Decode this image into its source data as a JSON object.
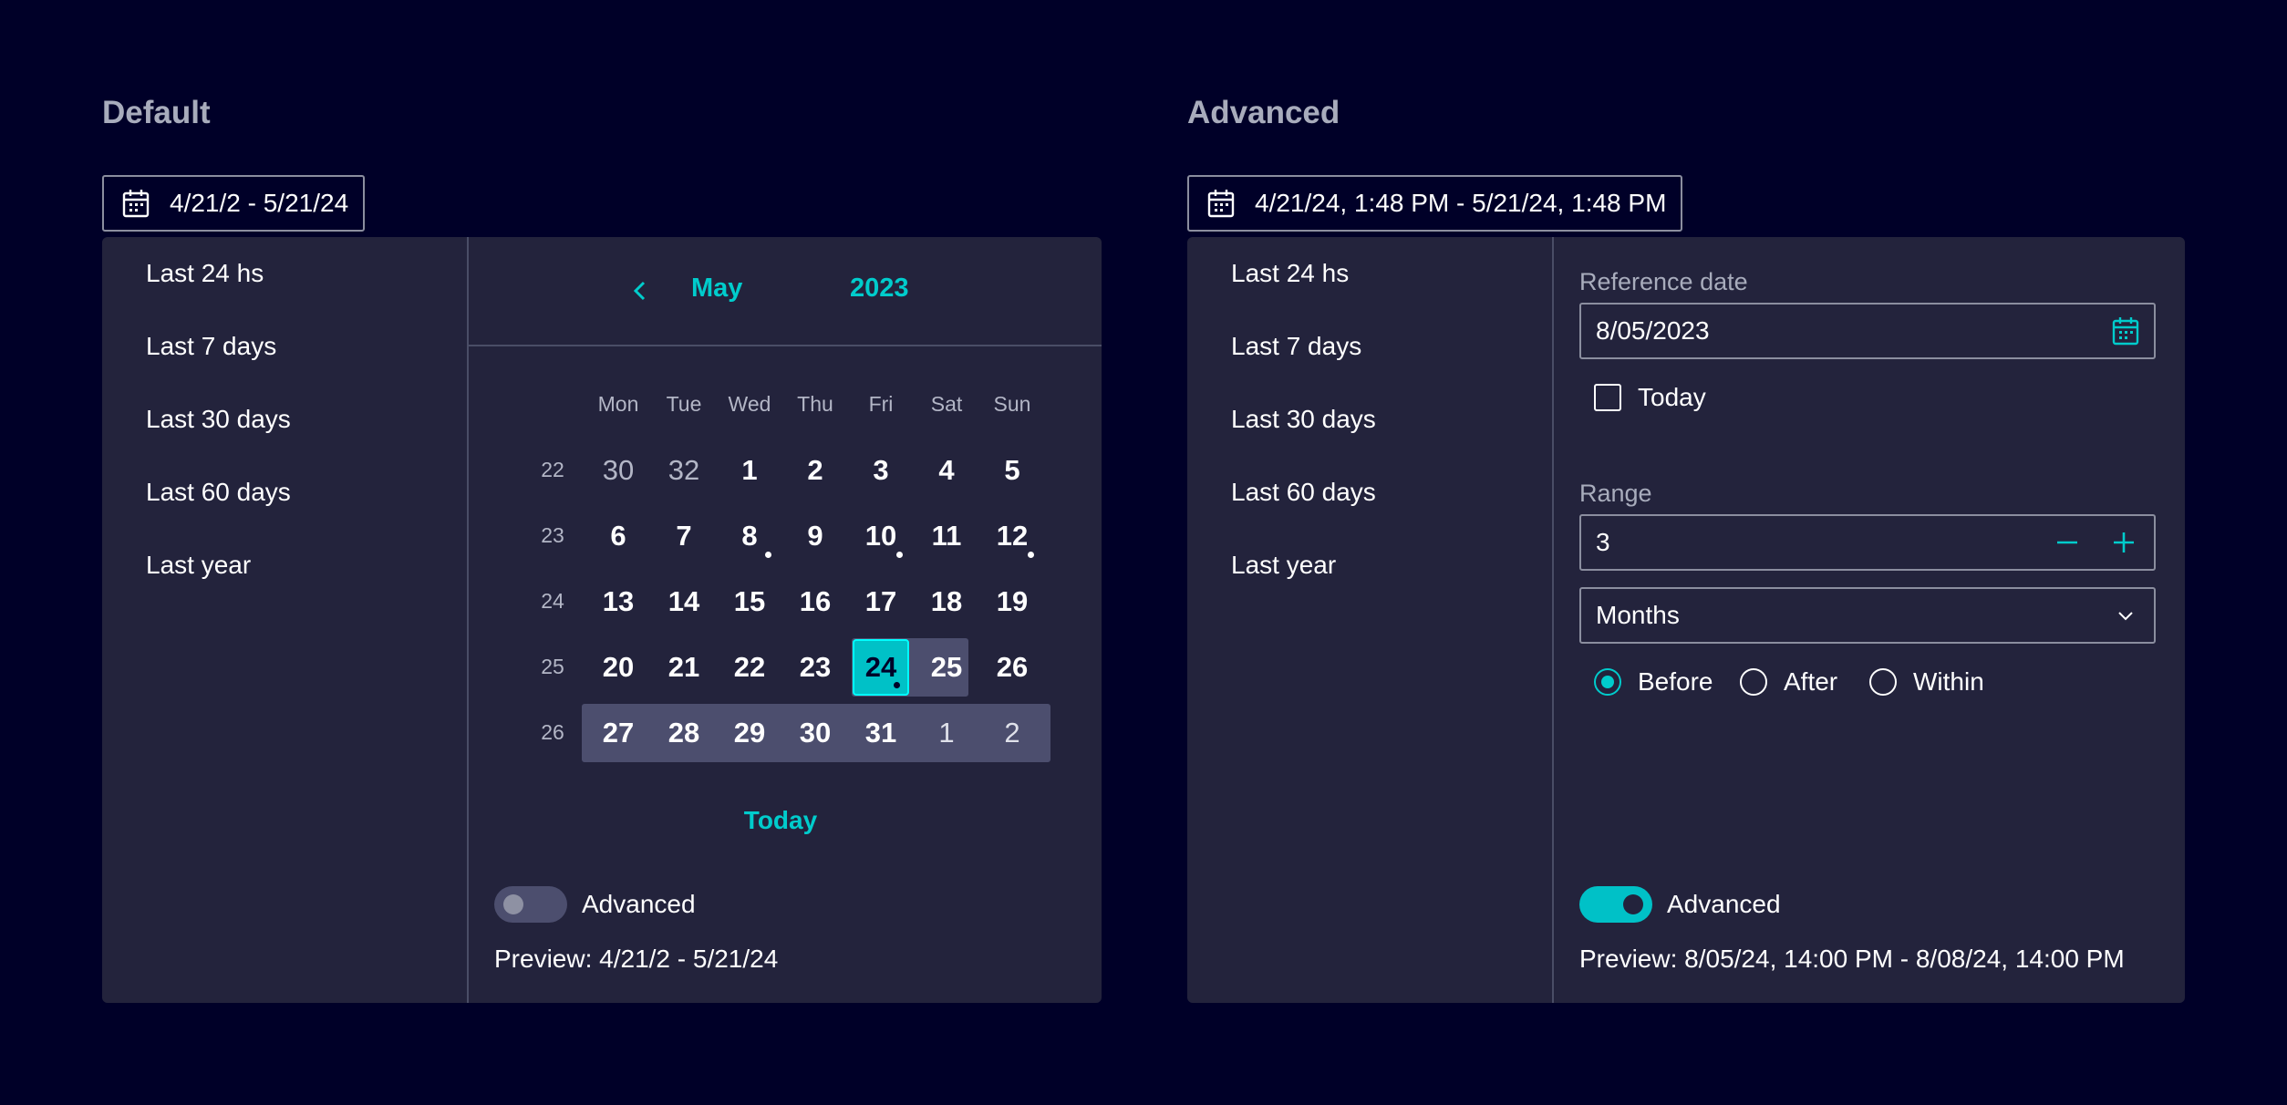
{
  "default": {
    "title": "Default",
    "trigger_value": "4/21/2 - 5/21/24",
    "presets": [
      "Last 24 hs",
      "Last 7 days",
      "Last 30 days",
      "Last 60 days",
      "Last year"
    ],
    "calendar": {
      "month": "May",
      "year": "2023",
      "weekdays": [
        "Mon",
        "Tue",
        "Wed",
        "Thu",
        "Fri",
        "Sat",
        "Sun"
      ],
      "weeks": [
        {
          "num": "22",
          "days": [
            "30",
            "32",
            "1",
            "2",
            "3",
            "4",
            "5"
          ]
        },
        {
          "num": "23",
          "days": [
            "6",
            "7",
            "8",
            "9",
            "10",
            "11",
            "12"
          ]
        },
        {
          "num": "24",
          "days": [
            "13",
            "14",
            "15",
            "16",
            "17",
            "18",
            "19"
          ]
        },
        {
          "num": "25",
          "days": [
            "20",
            "21",
            "22",
            "23",
            "24",
            "25",
            "26"
          ]
        },
        {
          "num": "26",
          "days": [
            "27",
            "28",
            "29",
            "30",
            "31",
            "1",
            "2"
          ]
        }
      ],
      "selected_day": "24",
      "today_label": "Today"
    },
    "advanced_label": "Advanced",
    "advanced_on": false,
    "preview": "Preview: 4/21/2 - 5/21/24"
  },
  "advanced": {
    "title": "Advanced",
    "trigger_value": "4/21/24, 1:48 PM - 5/21/24, 1:48 PM",
    "presets": [
      "Last 24 hs",
      "Last 7 days",
      "Last 30 days",
      "Last 60 days",
      "Last year"
    ],
    "reference_label": "Reference date",
    "reference_value": "8/05/2023",
    "today_checkbox_label": "Today",
    "range_label": "Range",
    "range_value": "3",
    "unit_value": "Months",
    "direction_options": [
      "Before",
      "After",
      "Within"
    ],
    "direction_selected": "Before",
    "advanced_label": "Advanced",
    "advanced_on": true,
    "preview": "Preview: 8/05/24, 14:00 PM - 8/08/24, 14:00 PM"
  },
  "colors": {
    "background": "#000028",
    "panel": "#23233c",
    "accent": "#00cccc",
    "range": "#4c4e6e"
  }
}
